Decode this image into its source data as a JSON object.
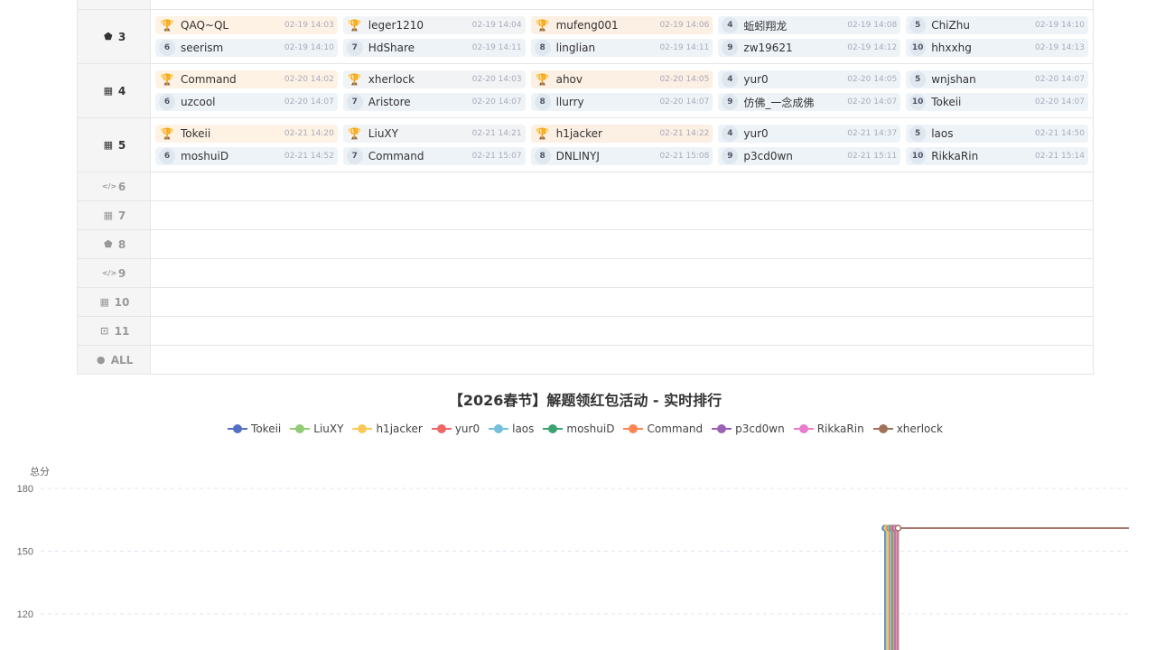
{
  "board": {
    "rows": [
      {
        "label": "3",
        "icon": "android-icon",
        "cells": [
          {
            "rank": "trophy",
            "tier": "gold",
            "name": "QAQ~QL",
            "time": "02-19 14:03"
          },
          {
            "rank": "trophy",
            "tier": "silver",
            "name": "leger1210",
            "time": "02-19 14:04"
          },
          {
            "rank": "trophy",
            "tier": "bronze",
            "name": "mufeng001",
            "time": "02-19 14:06"
          },
          {
            "rank": "4",
            "tier": "",
            "name": "蚯蚓翔龙",
            "time": "02-19 14:08"
          },
          {
            "rank": "5",
            "tier": "",
            "name": "ChiZhu",
            "time": "02-19 14:10"
          },
          {
            "rank": "6",
            "tier": "",
            "name": "seerism",
            "time": "02-19 14:10"
          },
          {
            "rank": "7",
            "tier": "",
            "name": "HdShare",
            "time": "02-19 14:11"
          },
          {
            "rank": "8",
            "tier": "",
            "name": "linglian",
            "time": "02-19 14:11"
          },
          {
            "rank": "9",
            "tier": "",
            "name": "zw19621",
            "time": "02-19 14:12"
          },
          {
            "rank": "10",
            "tier": "",
            "name": "hhxxhg",
            "time": "02-19 14:13"
          }
        ]
      },
      {
        "label": "4",
        "icon": "windows-icon",
        "cells": [
          {
            "rank": "trophy",
            "tier": "gold",
            "name": "Command",
            "time": "02-20 14:02"
          },
          {
            "rank": "trophy",
            "tier": "silver",
            "name": "xherlock",
            "time": "02-20 14:03"
          },
          {
            "rank": "trophy",
            "tier": "bronze",
            "name": "ahov",
            "time": "02-20 14:05"
          },
          {
            "rank": "4",
            "tier": "",
            "name": "yur0",
            "time": "02-20 14:05"
          },
          {
            "rank": "5",
            "tier": "",
            "name": "wnjshan",
            "time": "02-20 14:07"
          },
          {
            "rank": "6",
            "tier": "",
            "name": "uzcool",
            "time": "02-20 14:07"
          },
          {
            "rank": "7",
            "tier": "",
            "name": "Aristore",
            "time": "02-20 14:07"
          },
          {
            "rank": "8",
            "tier": "",
            "name": "llurry",
            "time": "02-20 14:07"
          },
          {
            "rank": "9",
            "tier": "",
            "name": "仿佛_一念成佛",
            "time": "02-20 14:07"
          },
          {
            "rank": "10",
            "tier": "",
            "name": "Tokeii",
            "time": "02-20 14:07"
          }
        ]
      },
      {
        "label": "5",
        "icon": "windows-icon",
        "cells": [
          {
            "rank": "trophy",
            "tier": "gold",
            "name": "Tokeii",
            "time": "02-21 14:20"
          },
          {
            "rank": "trophy",
            "tier": "silver",
            "name": "LiuXY",
            "time": "02-21 14:21"
          },
          {
            "rank": "trophy",
            "tier": "bronze",
            "name": "h1jacker",
            "time": "02-21 14:22"
          },
          {
            "rank": "4",
            "tier": "",
            "name": "yur0",
            "time": "02-21 14:37"
          },
          {
            "rank": "5",
            "tier": "",
            "name": "laos",
            "time": "02-21 14:50"
          },
          {
            "rank": "6",
            "tier": "",
            "name": "moshuiD",
            "time": "02-21 14:52"
          },
          {
            "rank": "7",
            "tier": "",
            "name": "Command",
            "time": "02-21 15:07"
          },
          {
            "rank": "8",
            "tier": "",
            "name": "DNLINYJ",
            "time": "02-21 15:08"
          },
          {
            "rank": "9",
            "tier": "",
            "name": "p3cd0wn",
            "time": "02-21 15:11"
          },
          {
            "rank": "10",
            "tier": "",
            "name": "RikkaRin",
            "time": "02-21 15:14"
          }
        ]
      }
    ],
    "empty_rows": [
      {
        "label": "6",
        "icon": "code-icon",
        "glyph": "</>"
      },
      {
        "label": "7",
        "icon": "windows-icon",
        "glyph": "▦"
      },
      {
        "label": "8",
        "icon": "android-icon",
        "glyph": "⬟"
      },
      {
        "label": "9",
        "icon": "code-icon",
        "glyph": "</>"
      },
      {
        "label": "10",
        "icon": "windows-icon",
        "glyph": "▦"
      },
      {
        "label": "11",
        "icon": "robot-icon",
        "glyph": "⊡"
      },
      {
        "label": "ALL",
        "icon": "medal-icon",
        "glyph": "●"
      }
    ]
  },
  "chart_data": {
    "type": "line",
    "title": "【2026春节】解题领红包活动 - 实时排行",
    "ylabel": "总分",
    "yticks": [
      120,
      150,
      180
    ],
    "series": [
      {
        "name": "Tokeii",
        "color": "#5470c6"
      },
      {
        "name": "LiuXY",
        "color": "#91cc75"
      },
      {
        "name": "h1jacker",
        "color": "#fac858"
      },
      {
        "name": "yur0",
        "color": "#ee6666"
      },
      {
        "name": "laos",
        "color": "#73c0de"
      },
      {
        "name": "moshuiD",
        "color": "#3ba272"
      },
      {
        "name": "Command",
        "color": "#fc8452"
      },
      {
        "name": "p3cd0wn",
        "color": "#9a60b4"
      },
      {
        "name": "RikkaRin",
        "color": "#ea7ccc"
      },
      {
        "name": "xherlock",
        "color": "#a0735a"
      }
    ],
    "plateau_value": 161
  }
}
